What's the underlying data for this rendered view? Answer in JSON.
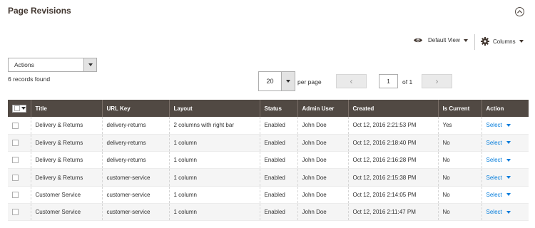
{
  "section": {
    "title": "Page Revisions"
  },
  "toolbar": {
    "view_label": "Default View",
    "columns_label": "Columns",
    "actions_label": "Actions",
    "records_found": "6 records found",
    "per_page_value": "20",
    "per_page_label": "per page",
    "prev_symbol": "‹",
    "next_symbol": "›",
    "current_page": "1",
    "of_pages": "of 1"
  },
  "table": {
    "headers": [
      "Title",
      "URL Key",
      "Layout",
      "Status",
      "Admin User",
      "Created",
      "Is Current",
      "Action"
    ],
    "rows": [
      [
        "Delivery & Returns",
        "delivery-returns",
        "2 columns with right bar",
        "Enabled",
        "John Doe",
        "Oct 12, 2016 2:21:53 PM",
        "Yes",
        "Select"
      ],
      [
        "Delivery & Returns",
        "delivery-returns",
        "1 column",
        "Enabled",
        "John Doe",
        "Oct 12, 2016 2:18:40 PM",
        "No",
        "Select"
      ],
      [
        "Delivery & Returns",
        "delivery-returns",
        "1 column",
        "Enabled",
        "John Doe",
        "Oct 12, 2016 2:16:28 PM",
        "No",
        "Select"
      ],
      [
        "Delivery & Returns",
        "customer-service",
        "1 column",
        "Enabled",
        "John Doe",
        "Oct 12, 2016 2:15:38 PM",
        "No",
        "Select"
      ],
      [
        "Customer Service",
        "customer-service",
        "1 column",
        "Enabled",
        "John Doe",
        "Oct 12, 2016 2:14:05 PM",
        "No",
        "Select"
      ],
      [
        "Customer Service",
        "customer-service",
        "1 column",
        "Enabled",
        "John Doe",
        "Oct 12, 2016 2:11:47 PM",
        "No",
        "Select"
      ]
    ]
  }
}
